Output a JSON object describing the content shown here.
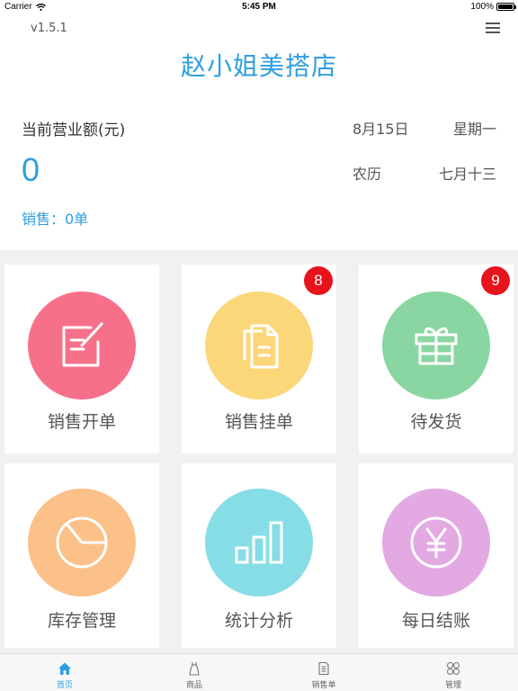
{
  "status_bar": {
    "carrier": "Carrier",
    "time": "5:45 PM",
    "battery": "100%"
  },
  "header": {
    "version": "v1.5.1",
    "store_name": "赵小姐美搭店",
    "revenue_label": "当前营业额(元)",
    "revenue_value": "0",
    "sales_count": "销售：0单",
    "date": "8月15日",
    "weekday": "星期一",
    "lunar_label": "农历",
    "lunar_date": "七月十三"
  },
  "tiles": [
    {
      "label": "销售开单",
      "color": "#f7708a",
      "icon": "edit-icon"
    },
    {
      "label": "销售挂单",
      "color": "#fcd77a",
      "icon": "documents-icon",
      "badge": "8"
    },
    {
      "label": "待发货",
      "color": "#8ad6a2",
      "icon": "gift-icon",
      "badge": "9"
    },
    {
      "label": "库存管理",
      "color": "#fbc188",
      "icon": "pie-chart-icon"
    },
    {
      "label": "统计分析",
      "color": "#86dde6",
      "icon": "bar-chart-icon"
    },
    {
      "label": "每日结账",
      "color": "#e3a9e3",
      "icon": "yen-icon"
    }
  ],
  "tab_bar": {
    "active_color": "#2f9fdf",
    "items": [
      {
        "label": "首页",
        "icon": "home-icon",
        "active": true
      },
      {
        "label": "商品",
        "icon": "dress-icon",
        "active": false
      },
      {
        "label": "销售单",
        "icon": "receipt-icon",
        "active": false
      },
      {
        "label": "管理",
        "icon": "grid-icon",
        "active": false
      }
    ]
  }
}
